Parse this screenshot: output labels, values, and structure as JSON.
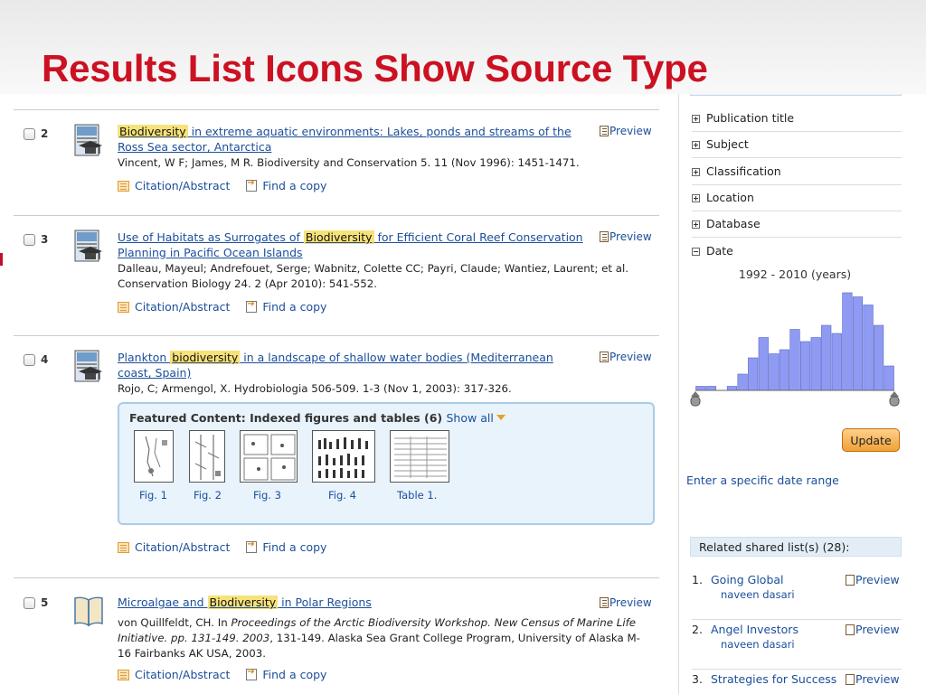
{
  "slide": {
    "title": "Results List Icons Show Source Type"
  },
  "results": [
    {
      "number": "2",
      "title_before": "",
      "highlight": "Biodiversity",
      "title_after": " in extreme aquatic environments: Lakes, ponds and streams of the Ross Sea sector, Antarctica",
      "authors": "Vincent, W F; James, M R. Biodiversity and Conservation 5. 11  (Nov 1996): 1451-1471.",
      "source_type_icon": "scholarly-journal-icon"
    },
    {
      "number": "3",
      "title_before": "Use of Habitats as Surrogates of ",
      "highlight": "Biodiversity",
      "title_after": " for Efficient Coral Reef Conservation Planning in Pacific Ocean Islands",
      "authors": "Dalleau, Mayeul; Andrefouet, Serge; Wabnitz, Colette CC; Payri, Claude; Wantiez, Laurent; et al. Conservation Biology 24. 2  (Apr 2010): 541-552.",
      "source_type_icon": "scholarly-journal-icon"
    },
    {
      "number": "4",
      "title_before": "Plankton ",
      "highlight": "biodiversity",
      "title_after": " in a landscape of shallow water bodies (Mediterranean coast, Spain)",
      "authors": "Rojo, C; Armengol, X. Hydrobiologia 506-509. 1-3  (Nov 1, 2003): 317-326.",
      "source_type_icon": "scholarly-journal-icon"
    },
    {
      "number": "5",
      "title_before": "Microalgae and ",
      "highlight": "Biodiversity",
      "title_after": " in Polar Regions",
      "authors_plain": "von Quillfeldt, CH. In ",
      "authors_italic": "Proceedings of the Arctic Biodiversity Workshop. New Census of Marine Life Initiative. pp. 131-149. 2003",
      "authors_rest": ", 131-149. Alaska Sea Grant College Program, University of Alaska M-16 Fairbanks AK USA, 2003.",
      "source_type_icon": "book-icon"
    }
  ],
  "labels": {
    "preview": "Preview",
    "citation": "Citation/Abstract",
    "find_copy": "Find a copy"
  },
  "featured": {
    "title": "Featured Content: Indexed figures and tables (6)",
    "show_all": "Show all",
    "thumbs": [
      "Fig. 1",
      "Fig. 2",
      "Fig. 3",
      "Fig. 4",
      "Table 1."
    ]
  },
  "sidebar": {
    "facets": [
      {
        "label": "Publication title",
        "expanded": false
      },
      {
        "label": "Subject",
        "expanded": false
      },
      {
        "label": "Classification",
        "expanded": false
      },
      {
        "label": "Location",
        "expanded": false
      },
      {
        "label": "Database",
        "expanded": false
      },
      {
        "label": "Date",
        "expanded": true
      }
    ],
    "date_range": "1992 - 2010 (years)",
    "update_label": "Update",
    "specific_date_label": "Enter a specific date range",
    "shared_header": "Related shared list(s) (28):",
    "shared_lists": [
      {
        "num": "1.",
        "title": "Going Global",
        "user": "naveen dasari"
      },
      {
        "num": "2.",
        "title": "Angel Investors",
        "user": "naveen dasari"
      },
      {
        "num": "3.",
        "title": "Strategies for Success",
        "user": ""
      }
    ]
  },
  "chart_data": {
    "type": "bar",
    "title": "1992 - 2010 (years)",
    "xlim": [
      1992,
      2010
    ],
    "values": [
      1,
      1,
      0,
      1,
      4,
      8,
      13,
      9,
      10,
      15,
      12,
      13,
      16,
      14,
      24,
      23,
      21,
      16,
      6
    ],
    "bar_color": "#8f9bf2"
  },
  "colors": {
    "title_red": "#cc1122",
    "link_blue": "#1b4e9b",
    "highlight": "#f7e27a",
    "featured_bg": "#e8f3fc"
  }
}
